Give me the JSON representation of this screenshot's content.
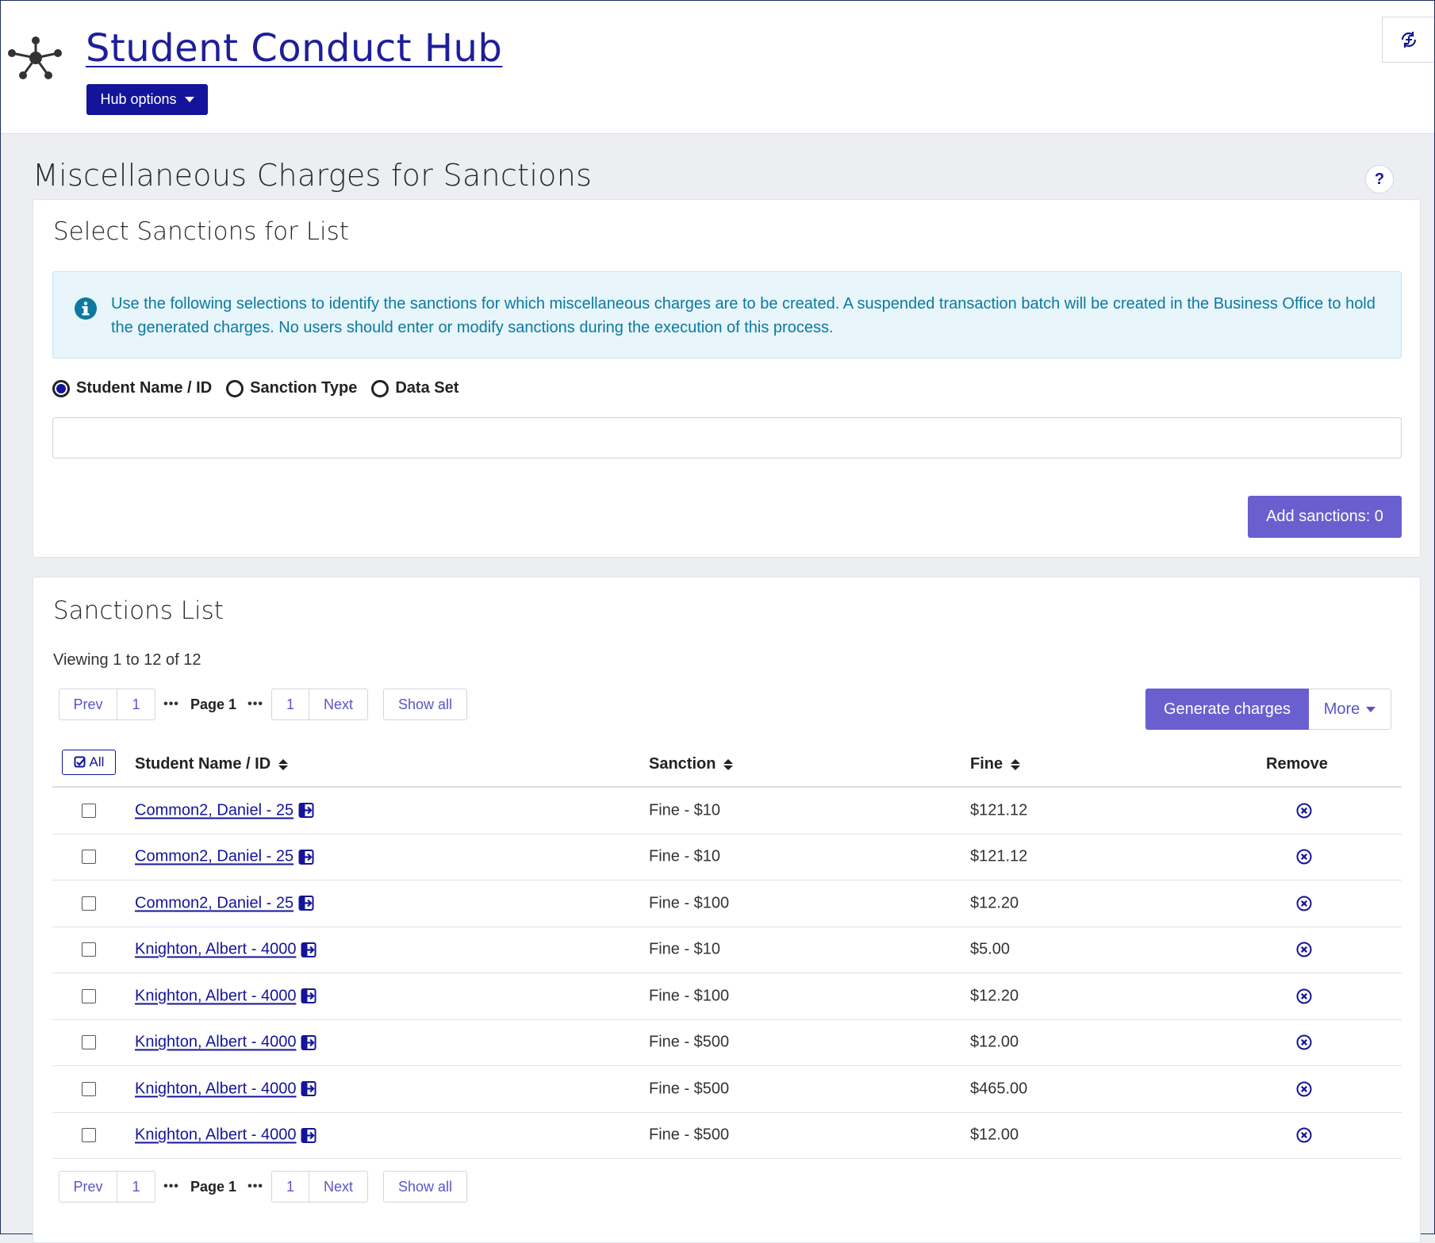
{
  "header": {
    "title": "Student Conduct Hub",
    "hub_options_label": "Hub options"
  },
  "page": {
    "title": "Miscellaneous Charges for Sanctions",
    "help_label": "?"
  },
  "select_panel": {
    "heading": "Select Sanctions for List",
    "info_text": "Use the following selections to identify the sanctions for which miscellaneous charges are to be created. A suspended transaction batch will be created in the Business Office to hold the generated charges. No users should enter or modify sanctions during the execution of this process.",
    "radios": [
      {
        "label": "Student Name / ID",
        "checked": true
      },
      {
        "label": "Sanction Type",
        "checked": false
      },
      {
        "label": "Data Set",
        "checked": false
      }
    ],
    "search_value": "",
    "add_button_label": "Add sanctions: 0"
  },
  "list_panel": {
    "heading": "Sanctions List",
    "viewing_text": "Viewing 1 to 12 of 12",
    "pager": {
      "prev": "Prev",
      "first": "1",
      "dots": "•••",
      "current": "Page 1",
      "last": "1",
      "next": "Next",
      "show_all": "Show all"
    },
    "generate_label": "Generate charges",
    "more_label": "More",
    "all_label": "All",
    "columns": {
      "student": "Student Name / ID",
      "sanction": "Sanction",
      "fine": "Fine",
      "remove": "Remove"
    },
    "rows": [
      {
        "student": "Common2, Daniel - 25",
        "sanction": "Fine - $10",
        "fine": "$121.12"
      },
      {
        "student": "Common2, Daniel - 25",
        "sanction": "Fine - $10",
        "fine": "$121.12"
      },
      {
        "student": "Common2, Daniel - 25",
        "sanction": "Fine - $100",
        "fine": "$12.20"
      },
      {
        "student": "Knighton, Albert - 4000",
        "sanction": "Fine - $10",
        "fine": "$5.00"
      },
      {
        "student": "Knighton, Albert - 4000",
        "sanction": "Fine - $100",
        "fine": "$12.20"
      },
      {
        "student": "Knighton, Albert - 4000",
        "sanction": "Fine - $500",
        "fine": "$12.00"
      },
      {
        "student": "Knighton, Albert - 4000",
        "sanction": "Fine - $500",
        "fine": "$465.00"
      },
      {
        "student": "Knighton, Albert - 4000",
        "sanction": "Fine - $500",
        "fine": "$12.00"
      }
    ]
  },
  "colors": {
    "brand_navy": "#14149a",
    "accent_purple": "#6a5fcf",
    "info_text": "#0b7a9e",
    "info_bg": "#e8f5fb",
    "page_bg": "#eceef2"
  },
  "icons": {
    "logo": "network-nodes-icon",
    "corner": "sync-refresh-icon",
    "info": "info-circle-icon",
    "student_link": "open-external-icon",
    "remove": "remove-circle-x-icon",
    "all": "check-square-icon"
  }
}
